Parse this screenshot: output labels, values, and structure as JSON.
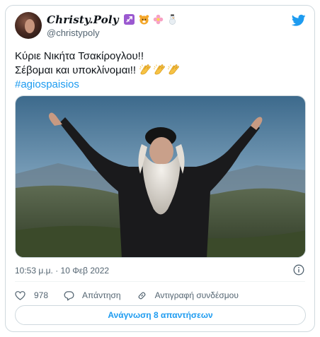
{
  "author": {
    "display_name": "Christy.Poly",
    "display_name_emojis": [
      "sagittarius-emoji",
      "tiger-emoji",
      "flower-emoji",
      "snowman-emoji"
    ],
    "handle": "@christypoly"
  },
  "tweet": {
    "line1": "Κύριε Νικήτα Τσακίρογλου!!",
    "line2": "Σέβομαι και υποκλίνομαι!!",
    "line2_emojis": [
      "clapping-hands-emoji",
      "clapping-hands-emoji",
      "clapping-hands-emoji"
    ],
    "hashtag": "#agiospaisios"
  },
  "meta": {
    "timestamp": "10:53 μ.μ. · 10 Φεβ 2022"
  },
  "actions": {
    "like_count": "978",
    "reply_label": "Απάντηση",
    "copy_link_label": "Αντιγραφή συνδέσμου"
  },
  "read_replies_label": "Ανάγνωση 8 απαντήσεων",
  "colors": {
    "accent": "#1d9bf0",
    "text": "#0f1419",
    "secondary": "#536471",
    "border": "#cfd9de"
  }
}
